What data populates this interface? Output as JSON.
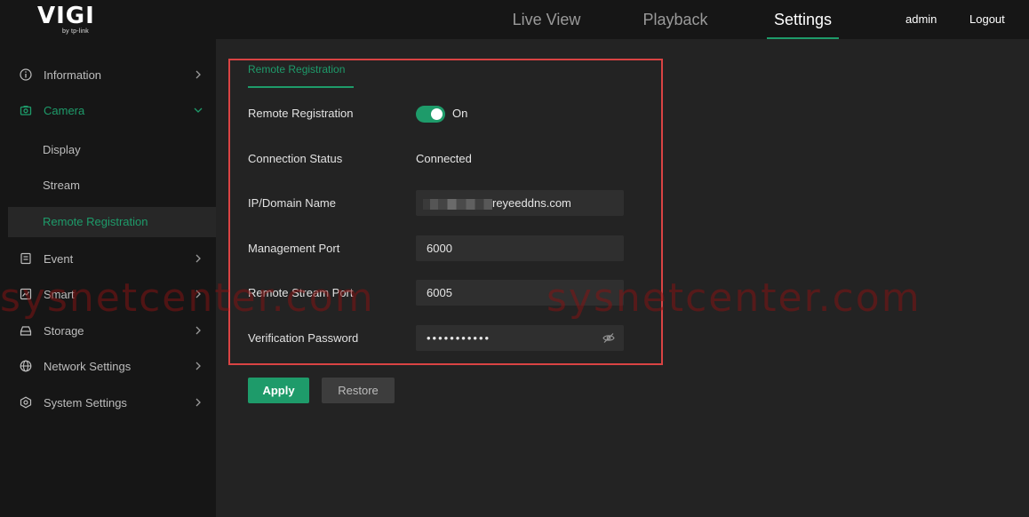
{
  "brand": {
    "name": "VIGI",
    "sub": "by tp-link"
  },
  "nav": {
    "tabs": [
      {
        "label": "Live View"
      },
      {
        "label": "Playback"
      },
      {
        "label": "Settings",
        "active": true
      }
    ],
    "user": "admin",
    "logout": "Logout"
  },
  "sidebar": {
    "items": [
      {
        "label": "Information",
        "icon": "info-icon"
      },
      {
        "label": "Camera",
        "icon": "camera-icon",
        "expanded": true
      },
      {
        "label": "Event",
        "icon": "event-icon"
      },
      {
        "label": "Smart",
        "icon": "smart-icon"
      },
      {
        "label": "Storage",
        "icon": "storage-icon"
      },
      {
        "label": "Network Settings",
        "icon": "globe-icon"
      },
      {
        "label": "System Settings",
        "icon": "settings-cube-icon"
      }
    ],
    "camera_sub": [
      {
        "label": "Display"
      },
      {
        "label": "Stream"
      },
      {
        "label": "Remote Registration",
        "selected": true
      }
    ]
  },
  "content": {
    "tab": "Remote Registration",
    "fields": {
      "remote_registration": {
        "label": "Remote Registration",
        "state": "On"
      },
      "connection_status": {
        "label": "Connection Status",
        "value": "Connected"
      },
      "domain": {
        "label": "IP/Domain Name",
        "value": "reyeeddns.com"
      },
      "mgmt_port": {
        "label": "Management Port",
        "value": "6000"
      },
      "stream_port": {
        "label": "Remote Stream Port",
        "value": "6005"
      },
      "password": {
        "label": "Verification Password",
        "value": "•••••••••••"
      }
    },
    "buttons": {
      "apply": "Apply",
      "restore": "Restore"
    }
  },
  "watermark": {
    "text": "sysnetcenter.com"
  },
  "colors": {
    "accent": "#1e9b6a",
    "highlight_border": "#d94343",
    "background": "#232323",
    "sidebar": "#161616"
  }
}
